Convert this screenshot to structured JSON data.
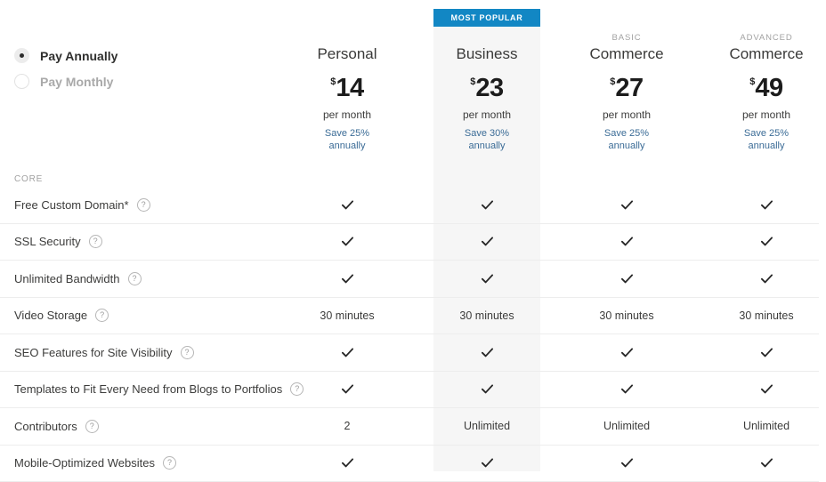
{
  "billing_toggle": {
    "options": [
      {
        "label": "Pay Annually",
        "selected": true
      },
      {
        "label": "Pay Monthly",
        "selected": false
      }
    ]
  },
  "badge": {
    "most_popular_label": "MOST POPULAR"
  },
  "colors": {
    "accent": "#1287c4",
    "highlight_column_bg": "#f6f6f6",
    "save_link": "#3a6b96",
    "row_divider": "#ededed",
    "muted_text": "#a2a2a2"
  },
  "plans": [
    {
      "eyebrow": "",
      "name": "Personal",
      "currency": "$",
      "amount": "14",
      "period": "per month",
      "save": "Save 25%\nannually",
      "save_line1": "Save 25%",
      "save_line2": "annually",
      "highlighted": false
    },
    {
      "eyebrow": "",
      "name": "Business",
      "currency": "$",
      "amount": "23",
      "period": "per month",
      "save": "Save 30%\nannually",
      "save_line1": "Save 30%",
      "save_line2": "annually",
      "highlighted": true
    },
    {
      "eyebrow": "BASIC",
      "name": "Commerce",
      "currency": "$",
      "amount": "27",
      "period": "per month",
      "save": "Save 25%\nannually",
      "save_line1": "Save 25%",
      "save_line2": "annually",
      "highlighted": false
    },
    {
      "eyebrow": "ADVANCED",
      "name": "Commerce",
      "currency": "$",
      "amount": "49",
      "period": "per month",
      "save": "Save 25%\nannually",
      "save_line1": "Save 25%",
      "save_line2": "annually",
      "highlighted": false
    }
  ],
  "sections": [
    {
      "label": "CORE",
      "rows": [
        {
          "feature": "Free Custom Domain*",
          "help": "?",
          "values": [
            "check",
            "check",
            "check",
            "check"
          ]
        },
        {
          "feature": "SSL Security",
          "help": "?",
          "values": [
            "check",
            "check",
            "check",
            "check"
          ]
        },
        {
          "feature": "Unlimited Bandwidth",
          "help": "?",
          "values": [
            "check",
            "check",
            "check",
            "check"
          ]
        },
        {
          "feature": "Video Storage",
          "help": "?",
          "values": [
            "30 minutes",
            "30 minutes",
            "30 minutes",
            "30 minutes"
          ]
        },
        {
          "feature": "SEO Features for Site Visibility",
          "help": "?",
          "values": [
            "check",
            "check",
            "check",
            "check"
          ]
        },
        {
          "feature": "Templates to Fit Every Need from Blogs to Portfolios",
          "help": "?",
          "values": [
            "check",
            "check",
            "check",
            "check"
          ]
        },
        {
          "feature": "Contributors",
          "help": "?",
          "values": [
            "2",
            "Unlimited",
            "Unlimited",
            "Unlimited"
          ]
        },
        {
          "feature": "Mobile-Optimized Websites",
          "help": "?",
          "values": [
            "check",
            "check",
            "check",
            "check"
          ]
        }
      ]
    }
  ]
}
